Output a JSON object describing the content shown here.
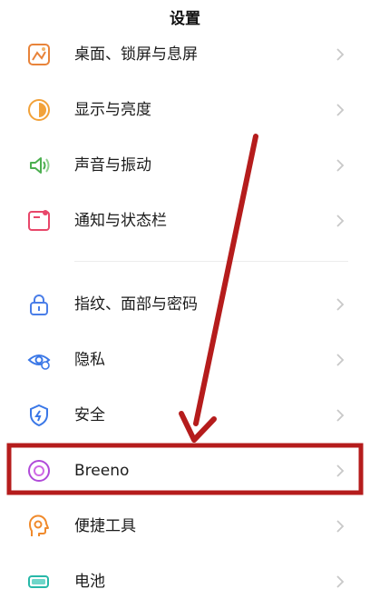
{
  "header": {
    "title": "设置"
  },
  "items": [
    {
      "id": "desktop",
      "label": "桌面、锁屏与息屏",
      "icon": "wallpaper-icon",
      "color": "#e8833a"
    },
    {
      "id": "display",
      "label": "显示与亮度",
      "icon": "brightness-icon",
      "color": "#f2a23a"
    },
    {
      "id": "sound",
      "label": "声音与振动",
      "icon": "speaker-icon",
      "color": "#4caf50"
    },
    {
      "id": "notifications",
      "label": "通知与状态栏",
      "icon": "notification-icon",
      "color": "#e8476a"
    },
    {
      "id": "security-passwords",
      "label": "指纹、面部与密码",
      "icon": "lock-icon",
      "color": "#4a7ee8"
    },
    {
      "id": "privacy",
      "label": "隐私",
      "icon": "eye-icon",
      "color": "#3b78e7"
    },
    {
      "id": "security",
      "label": "安全",
      "icon": "shield-icon",
      "color": "#3b78e7"
    },
    {
      "id": "breeno",
      "label": "Breeno",
      "icon": "breeno-icon",
      "color": "#b04ad9"
    },
    {
      "id": "tools",
      "label": "便捷工具",
      "icon": "tools-icon",
      "color": "#f08a2c"
    },
    {
      "id": "battery",
      "label": "电池",
      "icon": "battery-icon",
      "color": "#28b8a8"
    }
  ],
  "annotation": {
    "highlight_color": "#b51c1c",
    "highlighted_item": "Breeno"
  }
}
